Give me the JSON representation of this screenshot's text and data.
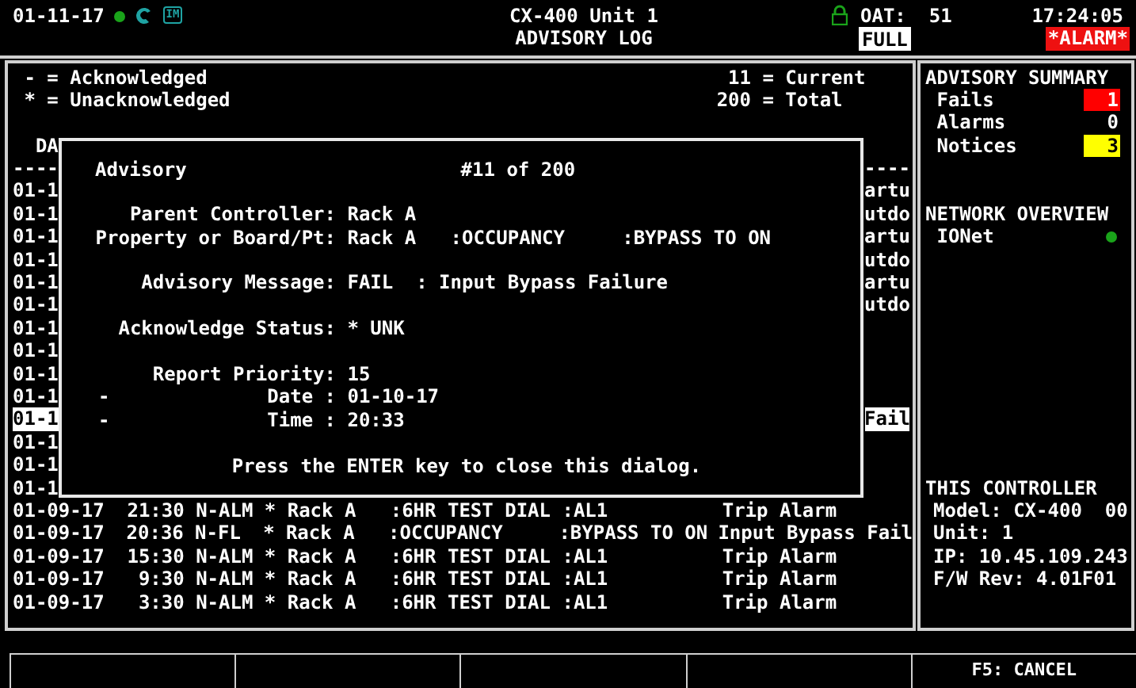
{
  "header": {
    "date": "01-11-17",
    "badge": "IM",
    "unit": "CX-400 Unit 1",
    "screen_title": "ADVISORY LOG",
    "oat": "OAT:  51",
    "mode": "FULL",
    "time": "17:24:05",
    "alarm": "*ALARM*"
  },
  "legend": [
    "- = Acknowledged",
    "* = Unacknowledged"
  ],
  "totals": [
    {
      "count": "11",
      "text": "= Current"
    },
    {
      "count": "200",
      "text": "= Total"
    }
  ],
  "table": {
    "header_fragment": "DA",
    "rule_left": "----",
    "rule_right": "----",
    "hidden_rows": [
      {
        "left": "01-1",
        "right": "artu",
        "selected": false
      },
      {
        "left": "01-1",
        "right": "utdo",
        "selected": false
      },
      {
        "left": "01-1",
        "right": "artu",
        "selected": false
      },
      {
        "left": "01-1",
        "right": "utdo",
        "selected": false
      },
      {
        "left": "01-1",
        "right": "artu",
        "selected": false
      },
      {
        "left": "01-1",
        "right": "utdo",
        "selected": false
      },
      {
        "left": "01-1",
        "selected": false
      },
      {
        "left": "01-1",
        "selected": false
      },
      {
        "left": "01-1",
        "selected": false
      },
      {
        "left": "01-1",
        "selected": false
      },
      {
        "left": "01-1",
        "right": "Fail",
        "selected": true
      },
      {
        "left": "01-1",
        "selected": false
      },
      {
        "left": "01-1",
        "selected": false
      },
      {
        "left": "01-1",
        "selected": false
      }
    ],
    "rows": [
      {
        "date": "01-09-17",
        "time": "21:30",
        "type": "N-ALM",
        "ack": "*",
        "source": "Rack A",
        "point": ":6HR TEST DIAL",
        "detail": ":AL1",
        "message": "Trip Alarm",
        "selected": false
      },
      {
        "date": "01-09-17",
        "time": "20:36",
        "type": "N-FL",
        "ack": "*",
        "source": "Rack A",
        "point": ":OCCUPANCY",
        "detail": ":BYPASS TO ON",
        "message": "Input Bypass Fail",
        "selected": false
      },
      {
        "date": "01-09-17",
        "time": "15:30",
        "type": "N-ALM",
        "ack": "*",
        "source": "Rack A",
        "point": ":6HR TEST DIAL",
        "detail": ":AL1",
        "message": "Trip Alarm",
        "selected": false
      },
      {
        "date": "01-09-17",
        "time": "9:30",
        "type": "N-ALM",
        "ack": "*",
        "source": "Rack A",
        "point": ":6HR TEST DIAL",
        "detail": ":AL1",
        "message": "Trip Alarm",
        "selected": false
      },
      {
        "date": "01-09-17",
        "time": "3:30",
        "type": "N-ALM",
        "ack": "*",
        "source": "Rack A",
        "point": ":6HR TEST DIAL",
        "detail": ":AL1",
        "message": "Trip Alarm",
        "selected": false
      }
    ]
  },
  "dialog": {
    "title": "Advisory",
    "counter": "#11 of 200",
    "footer": "Press the ENTER key to close this dialog.",
    "fields": [
      {
        "kind": "blank"
      },
      {
        "kind": "field",
        "label": "Parent Controller:",
        "value": "Rack A"
      },
      {
        "kind": "field",
        "label": "Property or Board/Pt:",
        "value": "Rack A   :OCCUPANCY     :BYPASS TO ON"
      },
      {
        "kind": "blank"
      },
      {
        "kind": "field",
        "label": "Advisory Message:",
        "value": "FAIL  : Input Bypass Failure"
      },
      {
        "kind": "blank"
      },
      {
        "kind": "field",
        "label": "Acknowledge Status:",
        "value": "* UNK"
      },
      {
        "kind": "blank"
      },
      {
        "kind": "field",
        "label": "Report Priority:",
        "value": "15"
      },
      {
        "kind": "field",
        "mark": "-",
        "label": "Date :",
        "value": "01-10-17"
      },
      {
        "kind": "field",
        "mark": "-",
        "label": "Time :",
        "value": "20:33"
      }
    ]
  },
  "summary": {
    "title": "ADVISORY SUMMARY",
    "items": [
      {
        "label": "Fails",
        "count": "1",
        "color": "#ff0000"
      },
      {
        "label": "Alarms",
        "count": "0"
      },
      {
        "label": "Notices",
        "count": "3",
        "color": "#ffff00"
      }
    ]
  },
  "network": {
    "title": "NETWORK OVERVIEW",
    "items": [
      {
        "label": "IONet"
      }
    ]
  },
  "controller": {
    "title": "THIS CONTROLLER",
    "lines": [
      "Model: CX-400  00",
      "Unit: 1",
      "IP: 10.45.109.243",
      "F/W Rev: 4.01F01"
    ]
  },
  "function_keys": [
    {
      "kind": "blank"
    },
    {
      "kind": "blank"
    },
    {
      "kind": "blank"
    },
    {
      "kind": "blank"
    },
    {
      "kind": "key",
      "label": "F5: CANCEL"
    }
  ]
}
